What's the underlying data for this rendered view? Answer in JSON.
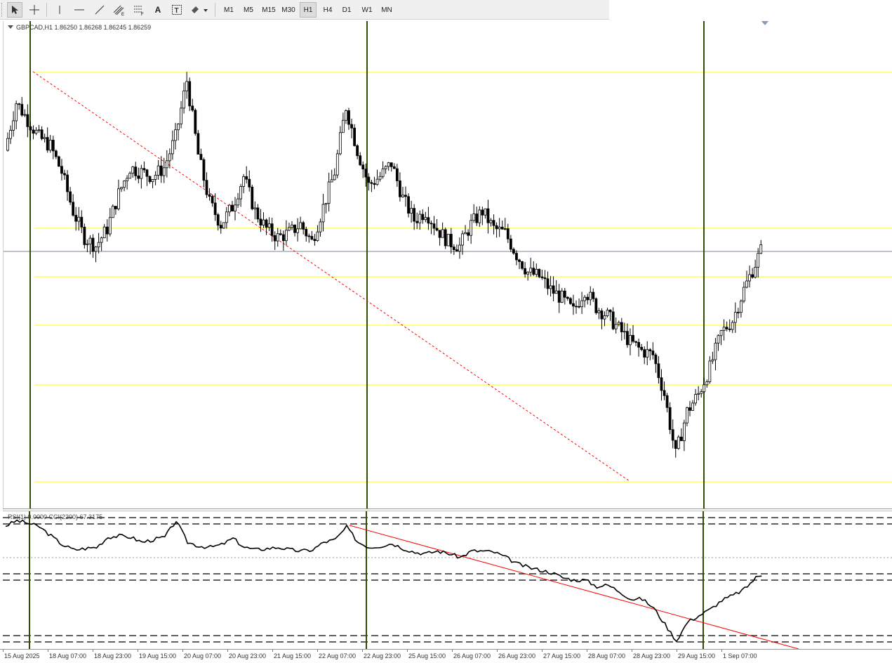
{
  "toolbar": {
    "tools": [
      {
        "name": "cursor-tool-button",
        "icon": "arrow-cursor-icon",
        "active": true
      },
      {
        "name": "crosshair-tool-button",
        "icon": "crosshair-icon",
        "active": false
      },
      {
        "name": "vertical-line-tool-button",
        "icon": "vertical-line-icon",
        "active": false
      },
      {
        "name": "horizontal-line-tool-button",
        "icon": "horizontal-line-icon",
        "active": false
      },
      {
        "name": "trendline-tool-button",
        "icon": "trendline-icon",
        "active": false
      },
      {
        "name": "channels-tool-button",
        "icon": "equidistant-channel-icon",
        "active": false
      },
      {
        "name": "fibonacci-tool-button",
        "icon": "fibonacci-icon",
        "active": false
      },
      {
        "name": "text-tool-button",
        "icon": "text-icon",
        "label": "A",
        "active": false
      },
      {
        "name": "text-label-tool-button",
        "icon": "text-label-icon",
        "label": "T",
        "active": false
      },
      {
        "name": "shapes-tool-button",
        "icon": "shapes-dropdown-icon",
        "active": false
      }
    ],
    "timeframes": [
      "M1",
      "M5",
      "M15",
      "M30",
      "H1",
      "H4",
      "D1",
      "W1",
      "MN"
    ],
    "active_timeframe": "H1"
  },
  "chart": {
    "symbol_line": "GBPCAD,H1  1.86250 1.86268 1.86245 1.86259",
    "subwindow_label": "RSI(1) 0.0000  CCI(2200) 67.3175"
  },
  "colors": {
    "candle": "#000000",
    "level_line": "#ffff00",
    "bid_line": "#778899",
    "vertical_marker": "#2f4f00",
    "trendline": "#ff0000",
    "indicator_line": "#000000"
  },
  "time_axis": [
    "15 Aug 2025",
    "18 Aug 07:00",
    "18 Aug 23:00",
    "19 Aug 15:00",
    "20 Aug 07:00",
    "20 Aug 23:00",
    "21 Aug 15:00",
    "22 Aug 07:00",
    "22 Aug 23:00",
    "25 Aug 15:00",
    "26 Aug 07:00",
    "26 Aug 23:00",
    "27 Aug 15:00",
    "28 Aug 07:00",
    "28 Aug 23:00",
    "29 Aug 15:00",
    "1 Sep 07:00"
  ],
  "chart_data": {
    "type": "candlestick",
    "symbol": "GBPCAD",
    "timeframe": "H1",
    "last_bar": {
      "open": 1.8625,
      "high": 1.86268,
      "low": 1.86245,
      "close": 1.86259
    },
    "price_path": [
      [
        0,
        0.8
      ],
      [
        4,
        0.91
      ],
      [
        8,
        0.87
      ],
      [
        12,
        0.83
      ],
      [
        16,
        0.81
      ],
      [
        20,
        0.75
      ],
      [
        24,
        0.66
      ],
      [
        28,
        0.6
      ],
      [
        32,
        0.58
      ],
      [
        36,
        0.62
      ],
      [
        40,
        0.7
      ],
      [
        44,
        0.76
      ],
      [
        48,
        0.75
      ],
      [
        52,
        0.74
      ],
      [
        56,
        0.76
      ],
      [
        60,
        0.83
      ],
      [
        64,
        0.96
      ],
      [
        68,
        0.79
      ],
      [
        72,
        0.68
      ],
      [
        76,
        0.63
      ],
      [
        80,
        0.67
      ],
      [
        84,
        0.74
      ],
      [
        88,
        0.66
      ],
      [
        92,
        0.62
      ],
      [
        96,
        0.6
      ],
      [
        100,
        0.61
      ],
      [
        104,
        0.63
      ],
      [
        108,
        0.59
      ],
      [
        112,
        0.67
      ],
      [
        116,
        0.75
      ],
      [
        120,
        0.9
      ],
      [
        124,
        0.8
      ],
      [
        128,
        0.72
      ],
      [
        132,
        0.74
      ],
      [
        136,
        0.77
      ],
      [
        140,
        0.69
      ],
      [
        144,
        0.64
      ],
      [
        148,
        0.66
      ],
      [
        152,
        0.62
      ],
      [
        156,
        0.59
      ],
      [
        160,
        0.58
      ],
      [
        164,
        0.63
      ],
      [
        168,
        0.66
      ],
      [
        172,
        0.62
      ],
      [
        176,
        0.61
      ],
      [
        180,
        0.56
      ],
      [
        184,
        0.52
      ],
      [
        188,
        0.51
      ],
      [
        192,
        0.48
      ],
      [
        196,
        0.46
      ],
      [
        200,
        0.43
      ],
      [
        204,
        0.48
      ],
      [
        208,
        0.44
      ],
      [
        212,
        0.42
      ],
      [
        216,
        0.39
      ],
      [
        220,
        0.36
      ],
      [
        224,
        0.34
      ],
      [
        228,
        0.33
      ],
      [
        232,
        0.24
      ],
      [
        236,
        0.1
      ],
      [
        240,
        0.2
      ],
      [
        244,
        0.24
      ],
      [
        248,
        0.3
      ],
      [
        252,
        0.38
      ],
      [
        256,
        0.41
      ],
      [
        260,
        0.48
      ],
      [
        264,
        0.54
      ],
      [
        266,
        0.57
      ]
    ],
    "price_levels": [
      "level-1",
      "level-2",
      "level-3",
      "level-4",
      "level-5",
      "level-6"
    ],
    "indicator": {
      "name": "RSI(1) / CCI(2200)",
      "rsi_value": 0.0,
      "cci_value": 67.3175,
      "path": [
        [
          0,
          0.93
        ],
        [
          4,
          0.97
        ],
        [
          8,
          0.95
        ],
        [
          12,
          0.92
        ],
        [
          16,
          0.85
        ],
        [
          20,
          0.78
        ],
        [
          24,
          0.74
        ],
        [
          28,
          0.75
        ],
        [
          32,
          0.76
        ],
        [
          36,
          0.84
        ],
        [
          40,
          0.85
        ],
        [
          44,
          0.84
        ],
        [
          48,
          0.8
        ],
        [
          52,
          0.82
        ],
        [
          56,
          0.84
        ],
        [
          60,
          0.97
        ],
        [
          64,
          0.8
        ],
        [
          68,
          0.77
        ],
        [
          72,
          0.76
        ],
        [
          76,
          0.78
        ],
        [
          80,
          0.83
        ],
        [
          84,
          0.76
        ],
        [
          88,
          0.74
        ],
        [
          92,
          0.75
        ],
        [
          96,
          0.76
        ],
        [
          100,
          0.74
        ],
        [
          104,
          0.73
        ],
        [
          108,
          0.74
        ],
        [
          112,
          0.8
        ],
        [
          116,
          0.82
        ],
        [
          120,
          0.92
        ],
        [
          124,
          0.8
        ],
        [
          128,
          0.76
        ],
        [
          132,
          0.77
        ],
        [
          136,
          0.79
        ],
        [
          140,
          0.75
        ],
        [
          144,
          0.72
        ],
        [
          148,
          0.71
        ],
        [
          152,
          0.73
        ],
        [
          156,
          0.71
        ],
        [
          160,
          0.68
        ],
        [
          164,
          0.73
        ],
        [
          168,
          0.73
        ],
        [
          172,
          0.72
        ],
        [
          176,
          0.68
        ],
        [
          180,
          0.63
        ],
        [
          184,
          0.6
        ],
        [
          188,
          0.58
        ],
        [
          192,
          0.56
        ],
        [
          196,
          0.52
        ],
        [
          200,
          0.5
        ],
        [
          204,
          0.5
        ],
        [
          208,
          0.45
        ],
        [
          212,
          0.46
        ],
        [
          216,
          0.41
        ],
        [
          220,
          0.35
        ],
        [
          224,
          0.35
        ],
        [
          228,
          0.28
        ],
        [
          232,
          0.15
        ],
        [
          236,
          0.02
        ],
        [
          240,
          0.17
        ],
        [
          244,
          0.22
        ],
        [
          248,
          0.27
        ],
        [
          252,
          0.34
        ],
        [
          256,
          0.38
        ],
        [
          260,
          0.43
        ],
        [
          264,
          0.52
        ],
        [
          266,
          0.54
        ]
      ]
    }
  }
}
